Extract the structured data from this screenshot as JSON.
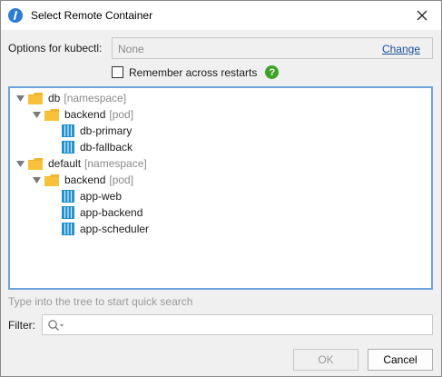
{
  "window": {
    "title": "Select Remote Container",
    "icon": "app-info-icon"
  },
  "options": {
    "label": "Options for kubectl:",
    "value": "None",
    "change_label": "Change"
  },
  "remember": {
    "label": "Remember across restarts",
    "checked": false
  },
  "tree": {
    "namespaces": [
      {
        "name": "db",
        "kind": "[namespace]",
        "pod": {
          "name": "backend",
          "kind": "[pod]",
          "containers": [
            "db-primary",
            "db-fallback"
          ]
        }
      },
      {
        "name": "default",
        "kind": "[namespace]",
        "pod": {
          "name": "backend",
          "kind": "[pod]",
          "containers": [
            "app-web",
            "app-backend",
            "app-scheduler"
          ]
        }
      }
    ]
  },
  "hint": "Type into the tree to start quick search",
  "filter": {
    "label": "Filter:",
    "value": ""
  },
  "buttons": {
    "ok": "OK",
    "cancel": "Cancel"
  },
  "colors": {
    "accent": "#2f7bd3",
    "folder": "#f4b52d",
    "container": "#1f8fcf",
    "help": "#3ea227",
    "selection_border": "#6fa3dc"
  }
}
